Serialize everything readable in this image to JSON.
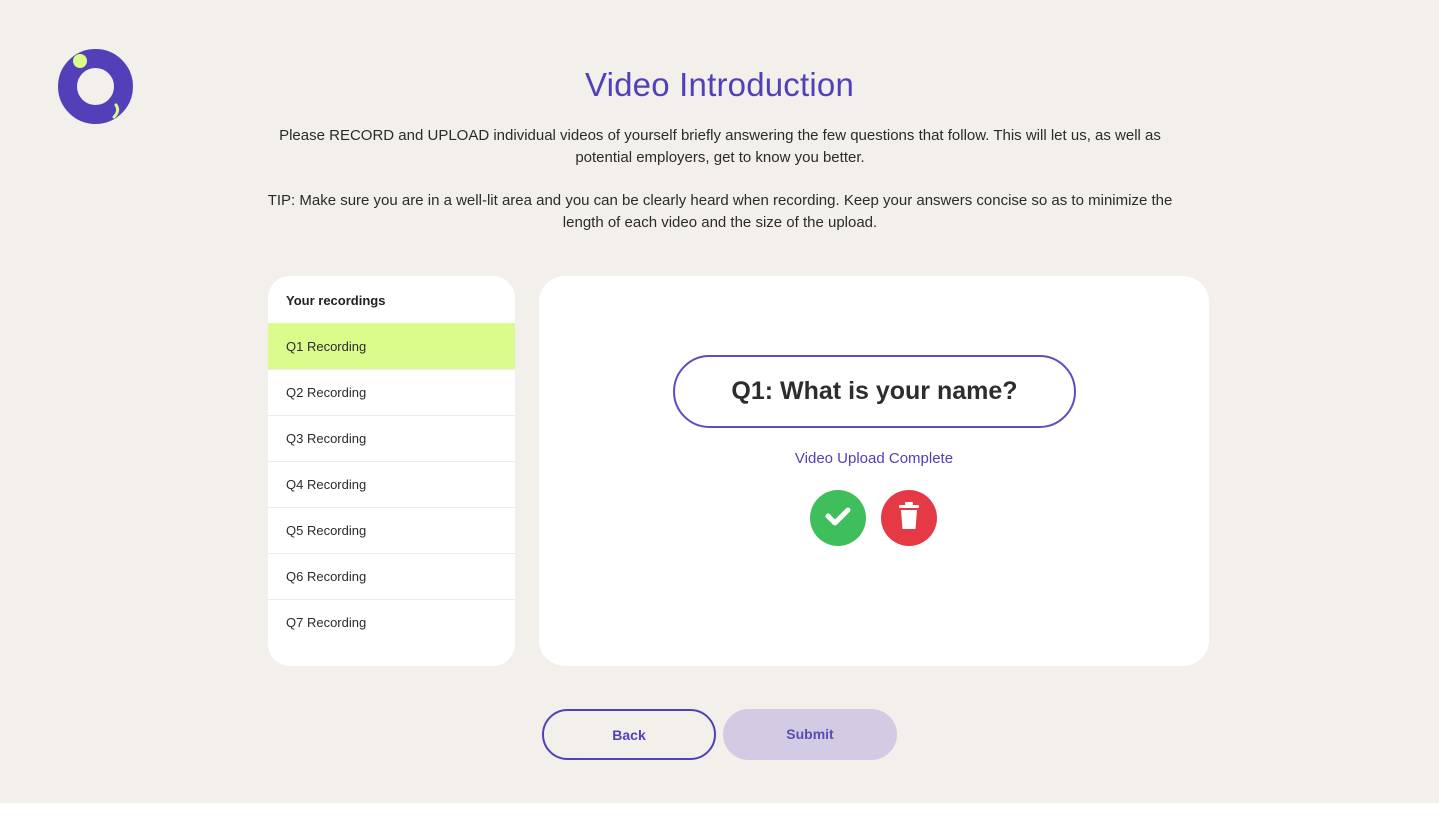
{
  "page": {
    "title": "Video Introduction",
    "intro": "Please RECORD and UPLOAD individual videos of yourself briefly answering the few questions that follow. This will let us, as well as potential employers, get to know you better.",
    "tip": "TIP: Make sure you are in a well-lit area and you can be clearly heard when recording. Keep your answers concise so as to minimize the length of each video and the size of the upload."
  },
  "sidebar": {
    "header": "Your recordings",
    "items": [
      {
        "label": "Q1 Recording",
        "active": true
      },
      {
        "label": "Q2 Recording",
        "active": false
      },
      {
        "label": "Q3 Recording",
        "active": false
      },
      {
        "label": "Q4 Recording",
        "active": false
      },
      {
        "label": "Q5 Recording",
        "active": false
      },
      {
        "label": "Q6 Recording",
        "active": false
      },
      {
        "label": "Q7 Recording",
        "active": false
      }
    ]
  },
  "main": {
    "question": "Q1: What is your name?",
    "status": "Video Upload Complete",
    "confirm_icon": "check-icon",
    "delete_icon": "trash-icon"
  },
  "footer": {
    "back_label": "Back",
    "submit_label": "Submit"
  },
  "colors": {
    "brand": "#5340b8",
    "accent_green": "#dafc8c",
    "success": "#3fbf5b",
    "danger": "#e53a45",
    "background": "#f3efeb"
  }
}
